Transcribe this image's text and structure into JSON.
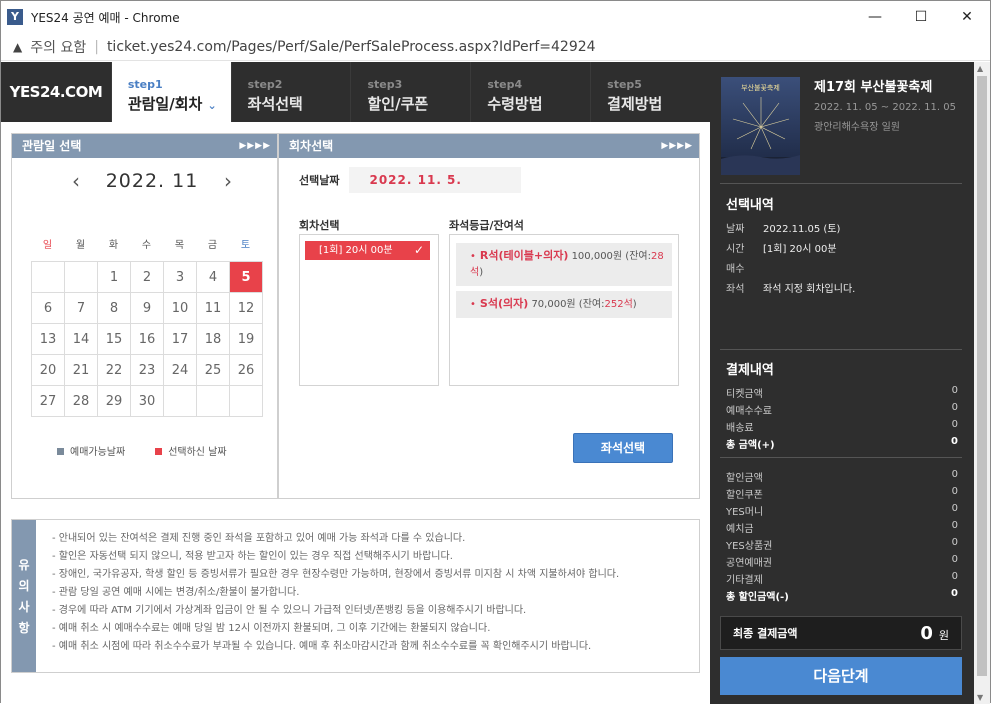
{
  "window": {
    "title": "YES24 공연 예매 - Chrome",
    "app_icon": "Y",
    "security": "주의 요함",
    "url": "ticket.yes24.com/Pages/Perf/Sale/PerfSaleProcess.aspx?IdPerf=42924"
  },
  "logo": "YES24.COM",
  "steps": [
    {
      "num": "step1",
      "label": "관람일/회차"
    },
    {
      "num": "step2",
      "label": "좌석선택"
    },
    {
      "num": "step3",
      "label": "할인/쿠폰"
    },
    {
      "num": "step4",
      "label": "수령방법"
    },
    {
      "num": "step5",
      "label": "결제방법"
    }
  ],
  "calendar": {
    "header": "관람일 선택",
    "month": "2022. 11",
    "days": [
      "일",
      "월",
      "화",
      "수",
      "목",
      "금",
      "토"
    ],
    "weeks": [
      [
        "",
        "",
        "1",
        "2",
        "3",
        "4",
        "5"
      ],
      [
        "6",
        "7",
        "8",
        "9",
        "10",
        "11",
        "12"
      ],
      [
        "13",
        "14",
        "15",
        "16",
        "17",
        "18",
        "19"
      ],
      [
        "20",
        "21",
        "22",
        "23",
        "24",
        "25",
        "26"
      ],
      [
        "27",
        "28",
        "29",
        "30",
        "",
        "",
        ""
      ]
    ],
    "legend_available": "예매가능날짜",
    "legend_selected": "선택하신 날짜"
  },
  "session": {
    "header": "회차선택",
    "date_label": "선택날짜",
    "date_value": "2022. 11. 5.",
    "session_label": "회차선택",
    "session_item": "[1회] 20시 00분",
    "grade_label": "좌석등급/잔여석",
    "grade1_name": "R석(테이블+의자)",
    "grade1_price": "100,000원 (잔여:",
    "grade1_remain": "28석",
    "grade2_name": "S석(의자)",
    "grade2_price": "70,000원 (잔여:",
    "grade2_remain": "252석",
    "select_button": "좌석선택"
  },
  "notice": {
    "title": [
      "유",
      "의",
      "사",
      "항"
    ],
    "lines": [
      "- 안내되어 있는 잔여석은 결제 진행 중인 좌석을 포함하고 있어 예매 가능 좌석과 다를 수 있습니다.",
      "- 할인은 자동선택 되지 않으니, 적용 받고자 하는 할인이 있는 경우 직접 선택해주시기 바랍니다.",
      "- 장애인, 국가유공자, 학생 할인 등 증빙서류가 필요한 경우 현장수령만 가능하며, 현장에서 증빙서류 미지참 시 차액 지불하셔야 합니다.",
      "- 관람 당일 공연 예매 시에는 변경/취소/환불이 불가합니다.",
      "- 경우에 따라 ATM 기기에서 가상계좌 입금이 안 될 수 있으니 가급적 인터넷/폰뱅킹 등을 이용해주시기 바랍니다.",
      "- 예매 취소 시 예매수수료는 예매 당일 밤 12시 이전까지 환불되며, 그 이후 기간에는 환불되지 않습니다.",
      "- 예매 취소 시점에 따라 취소수수료가 부과될 수 있습니다. 예매 후 취소마감시간과 함께 취소수수료를 꼭 확인해주시기 바랍니다."
    ]
  },
  "sidebar": {
    "poster_caption": "부산불꽃축제",
    "title": "제17회 부산불꽃축제",
    "dates": "2022. 11. 05 ~ 2022. 11. 05",
    "venue": "광안리해수욕장 일원",
    "selection_title": "선택내역",
    "selection": [
      {
        "k": "날짜",
        "v": "2022.11.05 (토)"
      },
      {
        "k": "시간",
        "v": "[1회] 20시 00분"
      },
      {
        "k": "매수",
        "v": ""
      },
      {
        "k": "좌석",
        "v": "좌석 지정 회차입니다."
      }
    ],
    "payment_title": "결제내역",
    "payment": [
      {
        "k": "티켓금액",
        "v": "0"
      },
      {
        "k": "예매수수료",
        "v": "0"
      },
      {
        "k": "배송료",
        "v": "0"
      },
      {
        "k": "총 금액(+)",
        "v": "0"
      }
    ],
    "discount": [
      {
        "k": "할인금액",
        "v": "0"
      },
      {
        "k": "할인쿠폰",
        "v": "0"
      },
      {
        "k": "YES머니",
        "v": "0"
      },
      {
        "k": "예치금",
        "v": "0"
      },
      {
        "k": "YES상품권",
        "v": "0"
      },
      {
        "k": "공연예매권",
        "v": "0"
      },
      {
        "k": "기타결제",
        "v": "0"
      },
      {
        "k": "총 할인금액(-)",
        "v": "0"
      }
    ],
    "final_label": "최종 결제금액",
    "final_value": "0",
    "final_unit": "원",
    "next_button": "다음단계"
  }
}
